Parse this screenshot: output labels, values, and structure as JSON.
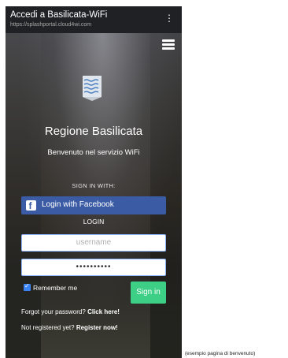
{
  "browser": {
    "title": "Accedi a Basilicata-WiFi",
    "url": "https://splashportal.cloud4wi.com",
    "menu_icon": "kebab-menu-icon"
  },
  "page": {
    "menu_icon": "hamburger-icon",
    "logo_icon": "regional-crest-icon",
    "region_name": "Regione Basilicata",
    "welcome_text": "Benvenuto nel servizio WiFi",
    "sign_in_with": "SIGN IN WITH:",
    "facebook_button": "Login with Facebook",
    "login_heading": "LOGIN",
    "username_placeholder": "username",
    "password_value": "••••••••••",
    "remember_label": "Remember me",
    "remember_checked": true,
    "signin_button": "Sign in",
    "forgot_text": "Forgot your password?",
    "forgot_link": "Click here!",
    "register_text": "Not registered yet?",
    "register_link": "Register now!"
  },
  "caption": "(esempio pagina di benvenuto)",
  "colors": {
    "facebook": "#3b5ca5",
    "signin": "#3ccf85",
    "checkbox": "#3b84f5",
    "browser_bar": "#202124"
  }
}
